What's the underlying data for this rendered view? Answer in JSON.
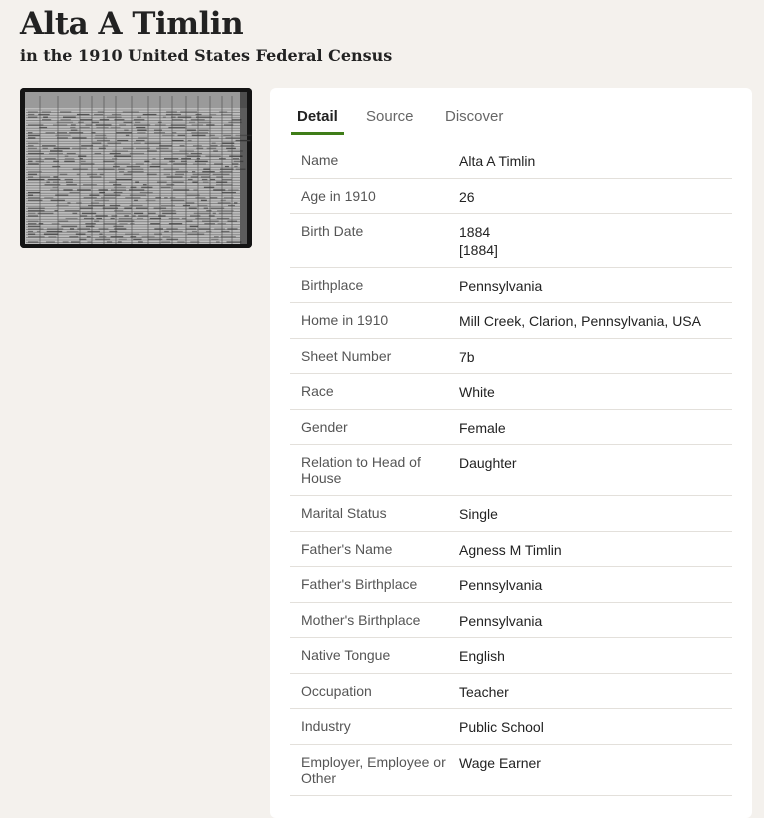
{
  "header": {
    "title": "Alta A Timlin",
    "subtitle": "in the 1910 United States Federal Census"
  },
  "tabs": [
    {
      "label": "Detail",
      "active": true
    },
    {
      "label": "Source",
      "active": false
    },
    {
      "label": "Discover",
      "active": false
    }
  ],
  "details": [
    {
      "label": "Name",
      "values": [
        "Alta A Timlin"
      ]
    },
    {
      "label": "Age in 1910",
      "values": [
        "26"
      ]
    },
    {
      "label": "Birth Date",
      "values": [
        "1884",
        "[1884]"
      ]
    },
    {
      "label": "Birthplace",
      "values": [
        "Pennsylvania"
      ]
    },
    {
      "label": "Home in 1910",
      "values": [
        "Mill Creek, Clarion, Pennsylvania, USA"
      ]
    },
    {
      "label": "Sheet Number",
      "values": [
        "7b"
      ]
    },
    {
      "label": "Race",
      "values": [
        "White"
      ]
    },
    {
      "label": "Gender",
      "values": [
        "Female"
      ]
    },
    {
      "label": "Relation to Head of House",
      "values": [
        "Daughter"
      ]
    },
    {
      "label": "Marital Status",
      "values": [
        "Single"
      ]
    },
    {
      "label": "Father's Name",
      "values": [
        "Agness M Timlin"
      ]
    },
    {
      "label": "Father's Birthplace",
      "values": [
        "Pennsylvania"
      ]
    },
    {
      "label": "Mother's Birthplace",
      "values": [
        "Pennsylvania"
      ]
    },
    {
      "label": "Native Tongue",
      "values": [
        "English"
      ]
    },
    {
      "label": "Occupation",
      "values": [
        "Teacher"
      ]
    },
    {
      "label": "Industry",
      "values": [
        "Public School"
      ]
    },
    {
      "label": "Employer, Employee or Other",
      "values": [
        "Wage Earner"
      ]
    }
  ],
  "colors": {
    "page_bg": "#f4f1ed",
    "card_bg": "#ffffff",
    "tab_underline": "#3f7d18",
    "divider": "#e3e0db"
  }
}
